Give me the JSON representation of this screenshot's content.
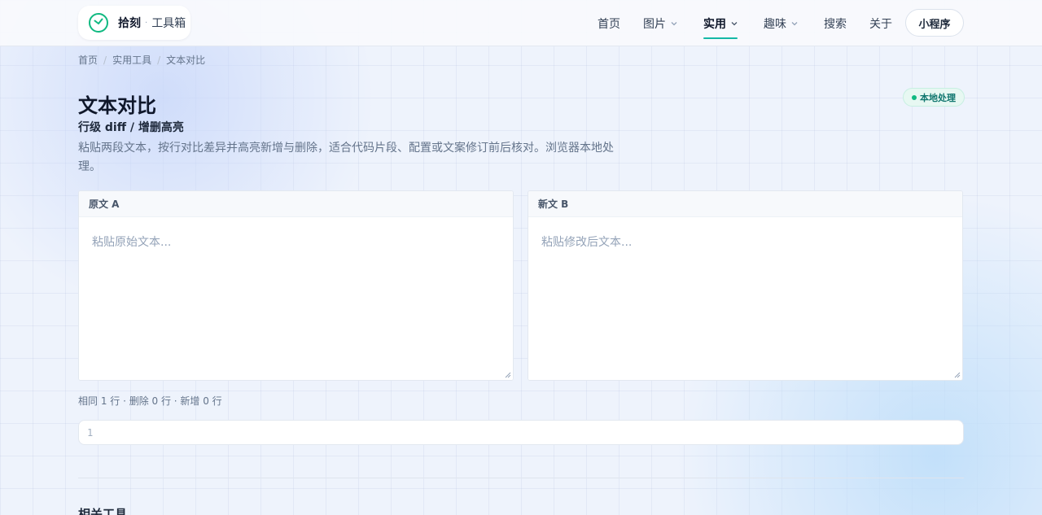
{
  "brand": {
    "name": "拾刻",
    "separator": "·",
    "subtitle": "工具箱"
  },
  "nav": {
    "items": [
      {
        "label": "首页",
        "has_dropdown": false,
        "active": false
      },
      {
        "label": "图片",
        "has_dropdown": true,
        "active": false
      },
      {
        "label": "实用",
        "has_dropdown": true,
        "active": true
      },
      {
        "label": "趣味",
        "has_dropdown": true,
        "active": false
      },
      {
        "label": "搜索",
        "has_dropdown": false,
        "active": false
      },
      {
        "label": "关于",
        "has_dropdown": false,
        "active": false
      }
    ],
    "mini_program_button": "小程序"
  },
  "breadcrumb": [
    "首页",
    "实用工具",
    "文本对比"
  ],
  "page": {
    "title": "文本对比",
    "badge": "本地处理",
    "subtitle": "行级 diff / 增删高亮",
    "description": "粘贴两段文本，按行对比差异并高亮新增与删除，适合代码片段、配置或文案修订前后核对。浏览器本地处理。"
  },
  "editors": {
    "left": {
      "label": "原文 A",
      "value": "",
      "placeholder": "粘贴原始文本..."
    },
    "right": {
      "label": "新文 B",
      "value": "",
      "placeholder": "粘贴修改后文本..."
    }
  },
  "stats": "相同 1 行 · 删除 0 行 · 新增 0 行",
  "result": {
    "line_numbers": [
      "1"
    ]
  },
  "related": {
    "title": "相关工具"
  },
  "colors": {
    "accent": "#14b8a6",
    "badge_bg": "#e7f8f2",
    "badge_text": "#0f766e",
    "text_primary": "#0f172a",
    "text_muted": "#64748b"
  }
}
